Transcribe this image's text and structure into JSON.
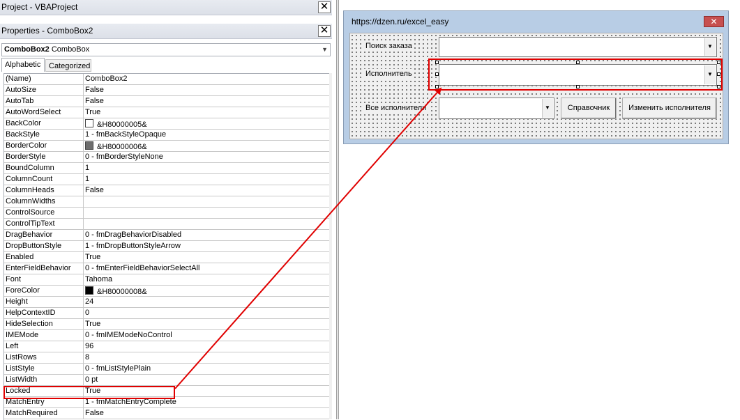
{
  "project_panel": {
    "title": "Project - VBAProject",
    "close_label": "✕"
  },
  "properties_panel": {
    "title": "Properties - ComboBox2",
    "close_label": "✕",
    "object_name": "ComboBox2",
    "object_type": "ComboBox",
    "tabs": [
      {
        "label": "Alphabetic"
      },
      {
        "label": "Categorized"
      }
    ],
    "rows": [
      {
        "name": "(Name)",
        "value": "ComboBox2"
      },
      {
        "name": "AutoSize",
        "value": "False"
      },
      {
        "name": "AutoTab",
        "value": "False"
      },
      {
        "name": "AutoWordSelect",
        "value": "True"
      },
      {
        "name": "BackColor",
        "value": "&H80000005&",
        "swatch": "#ffffff"
      },
      {
        "name": "BackStyle",
        "value": "1 - fmBackStyleOpaque"
      },
      {
        "name": "BorderColor",
        "value": "&H80000006&",
        "swatch": "#6d6d6d"
      },
      {
        "name": "BorderStyle",
        "value": "0 - fmBorderStyleNone"
      },
      {
        "name": "BoundColumn",
        "value": "1"
      },
      {
        "name": "ColumnCount",
        "value": "1"
      },
      {
        "name": "ColumnHeads",
        "value": "False"
      },
      {
        "name": "ColumnWidths",
        "value": ""
      },
      {
        "name": "ControlSource",
        "value": ""
      },
      {
        "name": "ControlTipText",
        "value": ""
      },
      {
        "name": "DragBehavior",
        "value": "0 - fmDragBehaviorDisabled"
      },
      {
        "name": "DropButtonStyle",
        "value": "1 - fmDropButtonStyleArrow"
      },
      {
        "name": "Enabled",
        "value": "True"
      },
      {
        "name": "EnterFieldBehavior",
        "value": "0 - fmEnterFieldBehaviorSelectAll"
      },
      {
        "name": "Font",
        "value": "Tahoma"
      },
      {
        "name": "ForeColor",
        "value": "&H80000008&",
        "swatch": "#000000"
      },
      {
        "name": "Height",
        "value": "24"
      },
      {
        "name": "HelpContextID",
        "value": "0"
      },
      {
        "name": "HideSelection",
        "value": "True"
      },
      {
        "name": "IMEMode",
        "value": "0 - fmIMEModeNoControl"
      },
      {
        "name": "Left",
        "value": "96"
      },
      {
        "name": "ListRows",
        "value": "8"
      },
      {
        "name": "ListStyle",
        "value": "0 - fmListStylePlain"
      },
      {
        "name": "ListWidth",
        "value": "0 pt"
      },
      {
        "name": "Locked",
        "value": "True"
      },
      {
        "name": "MatchEntry",
        "value": "1 - fmMatchEntryComplete"
      },
      {
        "name": "MatchRequired",
        "value": "False"
      }
    ]
  },
  "userform": {
    "title": "https://dzen.ru/excel_easy",
    "close_label": "✕",
    "labels": {
      "search_order": "Поиск заказа",
      "executor": "Исполнитель",
      "all_executors": "Все исполнители"
    },
    "buttons": {
      "reference": "Справочник",
      "change_executor": "Изменить исполнителя"
    }
  },
  "colors": {
    "highlight": "#e00000",
    "form_border": "#b8cde5",
    "close_red": "#c75050"
  }
}
